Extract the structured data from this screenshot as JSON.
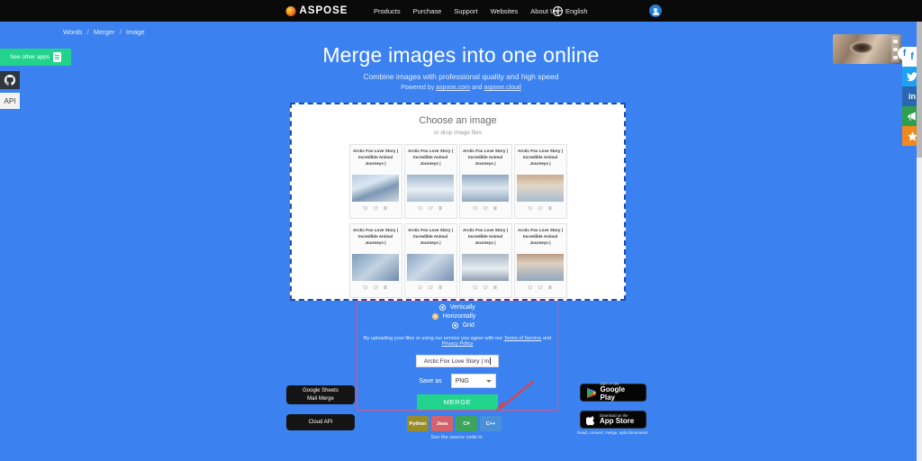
{
  "nav": {
    "brand": "ASPOSE",
    "links": [
      "Products",
      "Purchase",
      "Support",
      "Websites",
      "About Us"
    ],
    "language": "English"
  },
  "breadcrumb": {
    "items": [
      "Words",
      "Merger",
      "Image"
    ],
    "separator": "/"
  },
  "hero": {
    "title": "Merge images into one online",
    "subtitle": "Combine images with professional quality and high speed",
    "powered_prefix": "Powered by",
    "powered_link1": "aspose.com",
    "powered_and": "and",
    "powered_link2": "aspose.cloud"
  },
  "dropzone": {
    "title": "Choose an image",
    "hint": "or drop image files",
    "cards": [
      {
        "title": "Arctic Fox Love Story  |  Incredible Animal Journeys  |"
      },
      {
        "title": "Arctic Fox Love Story  |  Incredible Animal Journeys  |"
      },
      {
        "title": "Arctic Fox Love Story  |  Incredible Animal Journeys  |"
      },
      {
        "title": "Arctic Fox Love Story  |  Incredible Animal Journeys  |"
      },
      {
        "title": "Arctic Fox Love Story  |  Incredible Animal Journeys  |"
      },
      {
        "title": "Arctic Fox Love Story  |  Incredible Animal Journeys  |"
      },
      {
        "title": "Arctic Fox Love Story  |  Incredible Animal Journeys  |"
      },
      {
        "title": "Arctic Fox Love Story  |  Incredible Animal Journeys  |"
      }
    ]
  },
  "options": {
    "radios": [
      {
        "label": "Vertically",
        "selected": false
      },
      {
        "label": "Horizontally",
        "selected": true
      },
      {
        "label": "Grid",
        "selected": false
      }
    ],
    "terms_text": "By uploading your files or using our service you agree with our",
    "terms_link1": "Terms of Service",
    "terms_and": "and",
    "terms_link2": "Privacy Policy",
    "filename_value": "Arctic Fox Love Story  |  In",
    "save_as_label": "Save as",
    "format_value": "PNG",
    "merge_label": "MERGE"
  },
  "side_buttons": {
    "sheets_line1": "Google Sheets",
    "sheets_line2": "Mail Merge",
    "cloud_api": "Cloud API"
  },
  "stores": {
    "google_play_sub": "GET IT ON",
    "google_play_main": "Google Play",
    "app_store_sub": "Download on the",
    "app_store_main": "App Store",
    "caption": "Read, convert, merge, split documents"
  },
  "code_chips": {
    "items": [
      "Python",
      "Java",
      "C#",
      "C++"
    ],
    "caption": "See the source code in"
  },
  "left_rail": {
    "see_other_apps": "See other apps",
    "api_label": "API"
  },
  "social": {
    "items": [
      "facebook-icon",
      "twitter-icon",
      "linkedin-icon",
      "megaphone-icon",
      "star-icon"
    ]
  },
  "colors": {
    "page_background": "#3b82f0",
    "nav_background": "#0a0a0a",
    "merge_button": "#22d38c",
    "selected_radio": "#f5a623",
    "annotation_outline": "#e0527a"
  }
}
